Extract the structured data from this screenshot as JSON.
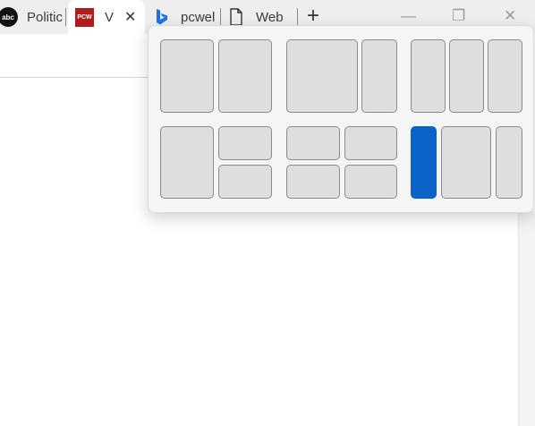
{
  "tabs": [
    {
      "title": "Politic",
      "icon": "abc-icon",
      "icon_text": "abc"
    },
    {
      "title": "V",
      "icon": "pcw-icon",
      "icon_text": "PCW",
      "active": true,
      "close_label": "✕"
    },
    {
      "title": "pcwel",
      "icon": "bing-icon"
    },
    {
      "title": "Web",
      "icon": "page-icon"
    }
  ],
  "new_tab_label": "+",
  "window_controls": {
    "minimize": "—",
    "restore": "❐",
    "close": "✕"
  },
  "colors": {
    "highlight_zone": "#0a64c8",
    "zone_fill": "#dedede",
    "zone_border": "#8b8b8b",
    "flyout_bg": "#f5f5f5",
    "tabbar_bg": "#eeeeee"
  },
  "snap_layouts": {
    "groups": 6,
    "highlighted": "layout 6, first zone"
  }
}
